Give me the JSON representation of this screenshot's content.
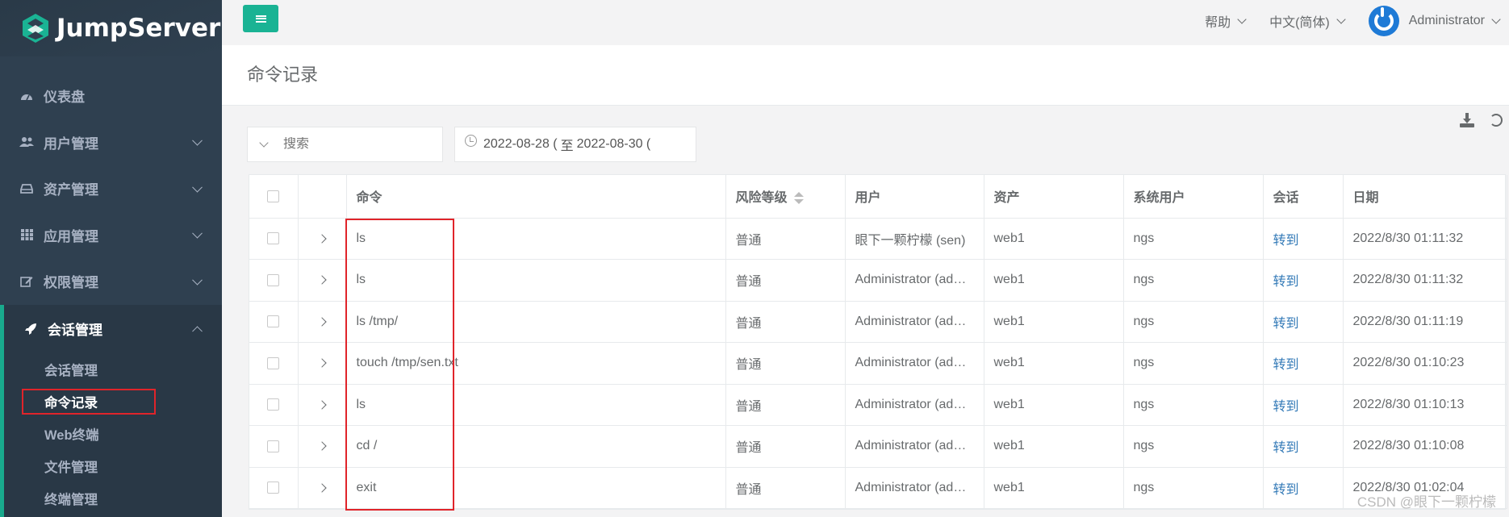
{
  "app": {
    "name": "JumpServer"
  },
  "sidebar": {
    "items": [
      {
        "label": "仪表盘",
        "icon": "dashboard-icon"
      },
      {
        "label": "用户管理",
        "icon": "users-icon"
      },
      {
        "label": "资产管理",
        "icon": "hdd-icon"
      },
      {
        "label": "应用管理",
        "icon": "grid-icon"
      },
      {
        "label": "权限管理",
        "icon": "edit-icon"
      }
    ],
    "active_group": {
      "label": "会话管理",
      "icon": "rocket-icon",
      "children": [
        "会话管理",
        "命令记录",
        "Web终端",
        "文件管理",
        "终端管理"
      ],
      "current_child": "命令记录"
    }
  },
  "topbar": {
    "help_label": "帮助",
    "language_label": "中文(简体)",
    "user_label": "Administrator"
  },
  "page": {
    "title": "命令记录"
  },
  "filters": {
    "search_placeholder": "搜索",
    "date_start": "2022-08-28 (",
    "date_sep": "至",
    "date_end": "2022-08-30 ("
  },
  "table": {
    "columns": [
      "命令",
      "风险等级",
      "用户",
      "资产",
      "系统用户",
      "会话",
      "日期"
    ],
    "rows": [
      {
        "command": "ls",
        "risk": "普通",
        "user": "眼下一颗柠檬 (sen)",
        "asset": "web1",
        "system_user": "ngs",
        "session": "转到",
        "date": "2022/8/30 01:11:32"
      },
      {
        "command": "ls",
        "risk": "普通",
        "user": "Administrator (ad…",
        "asset": "web1",
        "system_user": "ngs",
        "session": "转到",
        "date": "2022/8/30 01:11:32"
      },
      {
        "command": "ls /tmp/",
        "risk": "普通",
        "user": "Administrator (ad…",
        "asset": "web1",
        "system_user": "ngs",
        "session": "转到",
        "date": "2022/8/30 01:11:19"
      },
      {
        "command": "touch /tmp/sen.txt",
        "risk": "普通",
        "user": "Administrator (ad…",
        "asset": "web1",
        "system_user": "ngs",
        "session": "转到",
        "date": "2022/8/30 01:10:23"
      },
      {
        "command": "ls",
        "risk": "普通",
        "user": "Administrator (ad…",
        "asset": "web1",
        "system_user": "ngs",
        "session": "转到",
        "date": "2022/8/30 01:10:13"
      },
      {
        "command": "cd /",
        "risk": "普通",
        "user": "Administrator (ad…",
        "asset": "web1",
        "system_user": "ngs",
        "session": "转到",
        "date": "2022/8/30 01:10:08"
      },
      {
        "command": "exit",
        "risk": "普通",
        "user": "Administrator (ad…",
        "asset": "web1",
        "system_user": "ngs",
        "session": "转到",
        "date": "2022/8/30 01:02:04"
      }
    ]
  },
  "watermark": "CSDN @眼下一颗柠檬",
  "colors": {
    "sidebar_bg": "#2f4050",
    "accent": "#1ab394",
    "link": "#337ab7",
    "highlight": "#e0242a"
  }
}
